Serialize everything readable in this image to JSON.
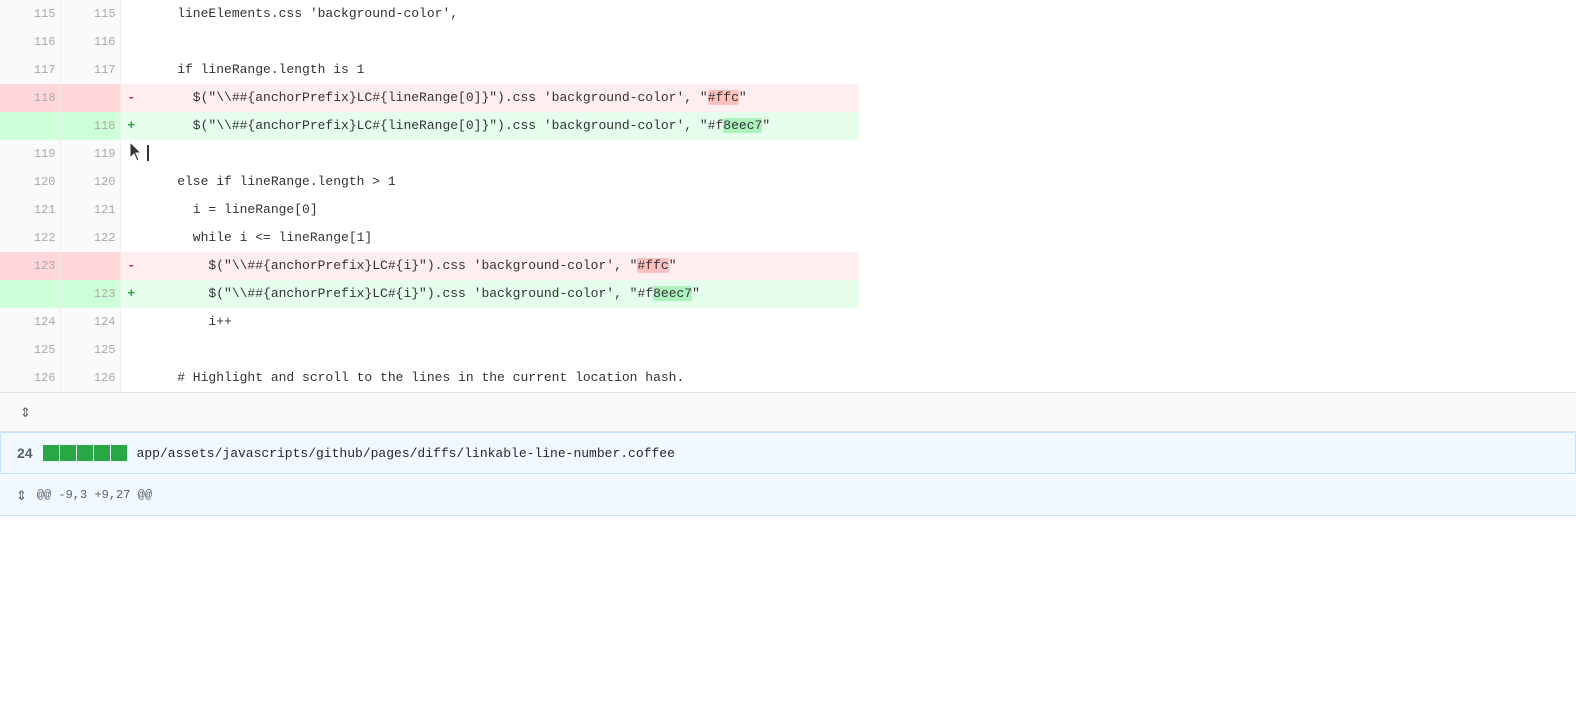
{
  "diff": {
    "rows": [
      {
        "old": "115",
        "new": "115",
        "type": "normal",
        "sign": "",
        "code": "    lineElements.css 'background-color',"
      },
      {
        "old": "116",
        "new": "116",
        "type": "normal",
        "sign": "",
        "code": ""
      },
      {
        "old": "117",
        "new": "117",
        "type": "normal",
        "sign": "",
        "code": "    if lineRange.length is 1"
      },
      {
        "old": "118",
        "new": "",
        "type": "deleted",
        "sign": "-",
        "code_parts": [
          {
            "text": "      $(\"\\\\##{anchorPrefix}LC#{lineRange[0]}\").css 'background-color', \"",
            "hl": false
          },
          {
            "text": "#ffc",
            "hl": true
          },
          {
            "text": "\"",
            "hl": false
          }
        ]
      },
      {
        "old": "",
        "new": "118",
        "type": "added",
        "sign": "+",
        "code_parts": [
          {
            "text": "      $(\"\\\\##{anchorPrefix}LC#{lineRange[0]}\").css 'background-color', \"#f",
            "hl": false
          },
          {
            "text": "8eec7",
            "hl": true
          },
          {
            "text": "\"",
            "hl": false
          }
        ]
      },
      {
        "old": "119",
        "new": "119",
        "type": "normal",
        "sign": "",
        "code": "",
        "cursor": true
      },
      {
        "old": "120",
        "new": "120",
        "type": "normal",
        "sign": "",
        "code": "    else if lineRange.length > 1"
      },
      {
        "old": "121",
        "new": "121",
        "type": "normal",
        "sign": "",
        "code": "      i = lineRange[0]"
      },
      {
        "old": "122",
        "new": "122",
        "type": "normal",
        "sign": "",
        "code": "      while i <= lineRange[1]"
      },
      {
        "old": "123",
        "new": "",
        "type": "deleted",
        "sign": "-",
        "code_parts": [
          {
            "text": "        $(\"\\\\##{anchorPrefix}LC#{i}\").css 'background-color', \"",
            "hl": false
          },
          {
            "text": "#ffc",
            "hl": true
          },
          {
            "text": "\"",
            "hl": false
          }
        ]
      },
      {
        "old": "",
        "new": "123",
        "type": "added",
        "sign": "+",
        "code_parts": [
          {
            "text": "        $(\"\\\\##{anchorPrefix}LC#{i}\").css 'background-color', \"#f",
            "hl": false
          },
          {
            "text": "8eec7",
            "hl": true
          },
          {
            "text": "\"",
            "hl": false
          }
        ]
      },
      {
        "old": "124",
        "new": "124",
        "type": "normal",
        "sign": "",
        "code": "        i++"
      },
      {
        "old": "125",
        "new": "125",
        "type": "normal",
        "sign": "",
        "code": ""
      },
      {
        "old": "126",
        "new": "126",
        "type": "normal",
        "sign": "",
        "code": "    # Highlight and scroll to the lines in the current location hash."
      }
    ],
    "separator_icon": "⇕",
    "expand_icon": "⇕"
  },
  "file_section": {
    "number": "24",
    "stat_blocks": 5,
    "path": "app/assets/javascripts/github/pages/diffs/linkable-line-number.coffee"
  },
  "hunk": {
    "expand_icon": "⇕",
    "info": "@@ -9,3 +9,27 @@"
  }
}
